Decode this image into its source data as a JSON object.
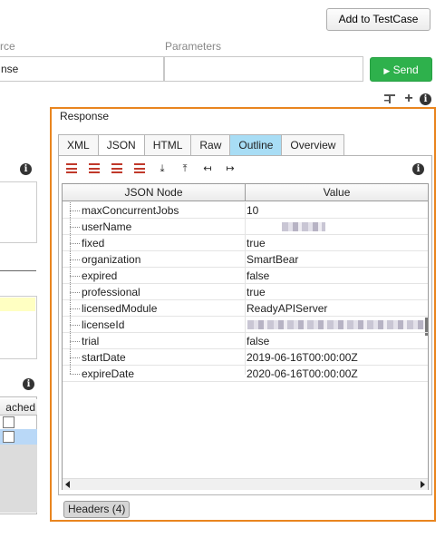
{
  "toolbar": {
    "add_testcase": "Add to TestCase",
    "send": "Send",
    "send_icon": "play-icon"
  },
  "request": {
    "source_label": "rce",
    "source_value": "nse",
    "parameters_label": "Parameters",
    "parameters_value": ""
  },
  "left": {
    "table_header": "ached"
  },
  "response": {
    "title": "Response",
    "tabs": [
      "XML",
      "JSON",
      "HTML",
      "Raw",
      "Outline",
      "Overview"
    ],
    "active_tab": "Outline",
    "columns": [
      "JSON Node",
      "Value"
    ],
    "rows": [
      {
        "key": "maxConcurrentJobs",
        "value": "10"
      },
      {
        "key": "userName",
        "value": ""
      },
      {
        "key": "fixed",
        "value": "true"
      },
      {
        "key": "organization",
        "value": "SmartBear"
      },
      {
        "key": "expired",
        "value": "false"
      },
      {
        "key": "professional",
        "value": "true"
      },
      {
        "key": "licensedModule",
        "value": "ReadyAPIServer"
      },
      {
        "key": "licenseId",
        "value": ""
      },
      {
        "key": "trial",
        "value": "false"
      },
      {
        "key": "startDate",
        "value": "2019-06-16T00:00:00Z"
      },
      {
        "key": "expireDate",
        "value": "2020-06-16T00:00:00Z"
      }
    ],
    "headers_button": "Headers (4)"
  },
  "colors": {
    "accent_border": "#e9851f",
    "send_green": "#2eb14c",
    "active_tab": "#a8ddf5",
    "selection": "#b9d8f7"
  }
}
